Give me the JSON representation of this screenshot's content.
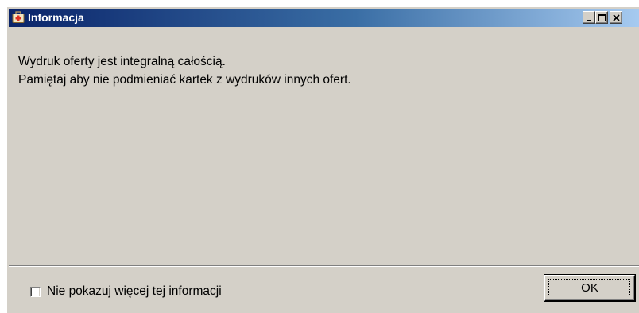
{
  "window": {
    "title": "Informacja",
    "icon": "medical-kit-icon",
    "titlebar_color_start": "#0a246a",
    "titlebar_color_end": "#a6caf0",
    "controls": {
      "minimize_icon": "minimize-icon",
      "maximize_icon": "maximize-icon",
      "close_icon": "close-icon"
    }
  },
  "message": {
    "line1": "Wydruk oferty jest integralną całością.",
    "line2": "Pamiętaj aby nie podmieniać kartek z wydruków innych ofert."
  },
  "footer": {
    "checkbox_label": "Nie pokazuj więcej tej informacji",
    "checkbox_checked": false,
    "ok_label": "OK"
  }
}
